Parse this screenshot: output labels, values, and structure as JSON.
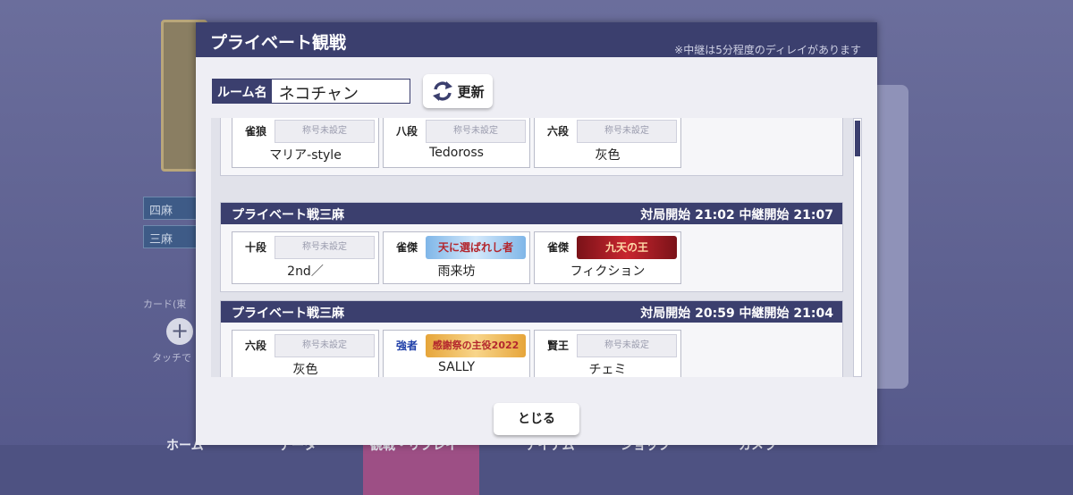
{
  "background": {
    "tags": [
      "四麻",
      "三麻"
    ],
    "card_label": "カード(東",
    "touch_hint": "タッチで",
    "nav": [
      "ホーム",
      "データ",
      "観戦・リプレイ",
      "アイテム",
      "ショップ",
      "カメラ"
    ]
  },
  "modal": {
    "title": "プライベート観戦",
    "note": "※中継は5分程度のディレイがあります",
    "room_label": "ルーム名",
    "room_value": "ネコチャン",
    "refresh_label": "更新",
    "close_label": "とじる"
  },
  "rooms": [
    {
      "type": "",
      "times": "",
      "players": [
        {
          "rank": "雀狼",
          "title": "称号未設定",
          "name": "マリア-style"
        },
        {
          "rank": "八段",
          "title": "称号未設定",
          "name": "Tedoross"
        },
        {
          "rank": "六段",
          "title": "称号未設定",
          "name": "灰色"
        }
      ]
    },
    {
      "type": "プライベート戦三麻",
      "times": "対局開始 21:02 中継開始 21:07",
      "players": [
        {
          "rank": "十段",
          "title": "称号未設定",
          "name": "2nd／"
        },
        {
          "rank": "雀傑",
          "title": "天に選ばれし者",
          "name": "雨来坊"
        },
        {
          "rank": "雀傑",
          "title": "九天の王",
          "name": "フィクション"
        }
      ]
    },
    {
      "type": "プライベート戦三麻",
      "times": "対局開始 20:59 中継開始 21:04",
      "players": [
        {
          "rank": "六段",
          "title": "称号未設定",
          "name": "灰色"
        },
        {
          "rank": "強者",
          "title": "感謝祭の主役2022",
          "name": "SALLY"
        },
        {
          "rank": "賢王",
          "title": "称号未設定",
          "name": "チェミ"
        }
      ]
    }
  ],
  "colors": {
    "header": "#3b3f6e",
    "accent_banner_blue": "#7fb6e8",
    "accent_banner_red": "#b3262d",
    "accent_banner_gold": "#e6a53a"
  }
}
